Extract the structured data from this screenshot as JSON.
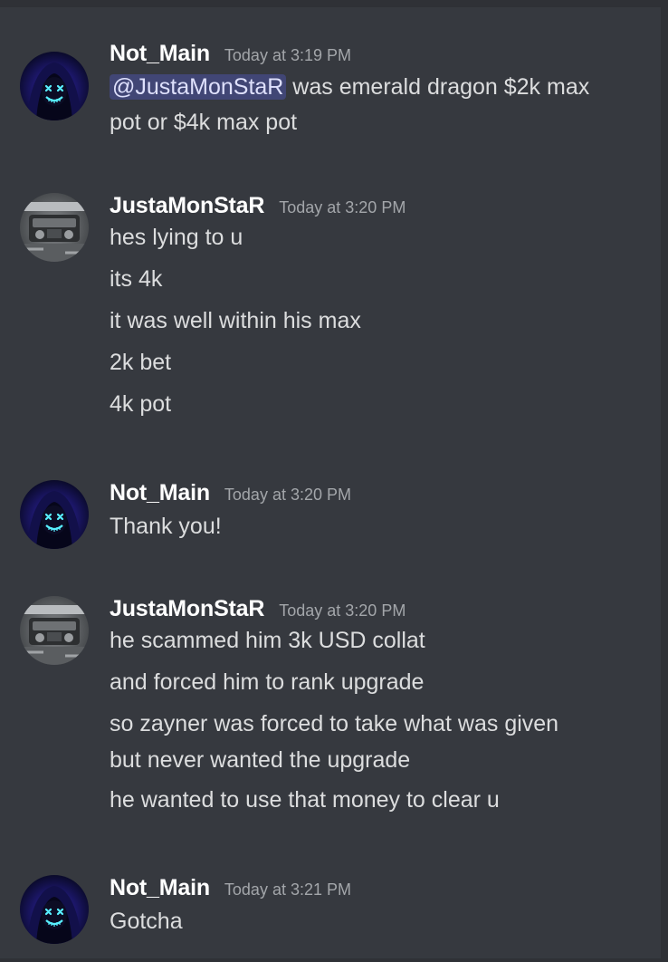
{
  "messages": [
    {
      "author": "Not_Main",
      "timestamp": "Today at 3:19 PM",
      "avatar_icon": "hooded-neon-mask-avatar",
      "mention": "@JustaMonStaR",
      "first_line_rest": " was emerald dragon $2k max",
      "second_line": "pot or $4k max pot"
    },
    {
      "author": "JustaMonStaR",
      "timestamp": "Today at 3:20 PM",
      "avatar_icon": "engine-bay-photo-avatar",
      "lines": [
        "hes lying to u",
        "its 4k",
        "it was well within his max",
        "2k bet",
        "4k pot"
      ]
    },
    {
      "author": "Not_Main",
      "timestamp": "Today at 3:20 PM",
      "avatar_icon": "hooded-neon-mask-avatar",
      "lines": [
        "Thank you!"
      ]
    },
    {
      "author": "JustaMonStaR",
      "timestamp": "Today at 3:20 PM",
      "avatar_icon": "engine-bay-photo-avatar",
      "lines": [
        "he scammed him 3k USD collat",
        "and forced him to rank upgrade"
      ],
      "wrapped_line_1": "so zayner was forced to take what was given",
      "wrapped_line_2": "but never wanted the upgrade",
      "last_line": "he wanted to use that money to clear u"
    },
    {
      "author": "Not_Main",
      "timestamp": "Today at 3:21 PM",
      "avatar_icon": "hooded-neon-mask-avatar",
      "lines": [
        "Gotcha"
      ]
    }
  ],
  "colors": {
    "background": "#36393f",
    "border": "#2f3136",
    "username": "#ffffff",
    "message_text": "#dcddde",
    "timestamp": "#a3a6aa",
    "mention_bg": "#414675",
    "mention_text": "#dee0fc"
  }
}
